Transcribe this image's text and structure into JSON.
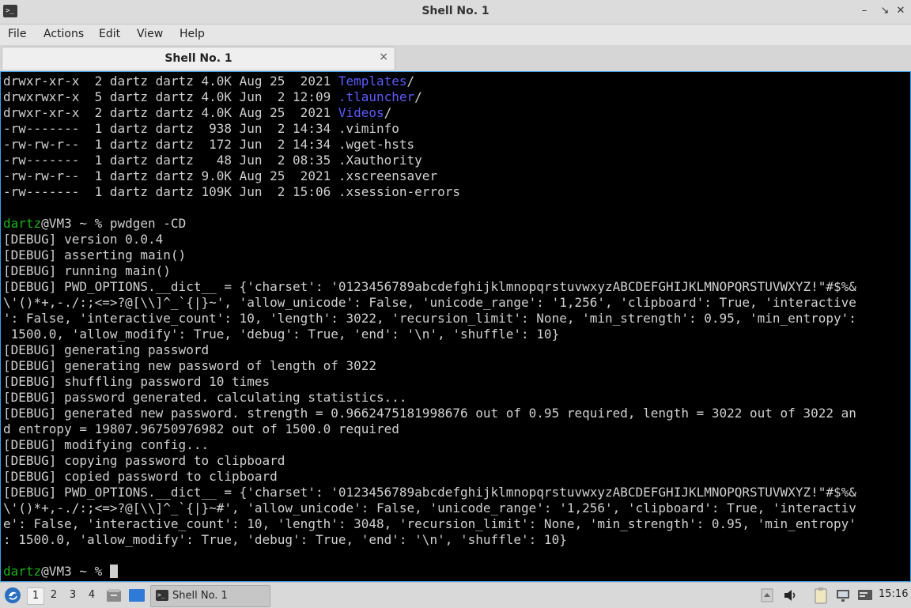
{
  "window": {
    "title": "Shell No. 1",
    "app_icon": "terminal-icon",
    "controls": [
      "minimize-icon",
      "maximize-icon",
      "close-icon"
    ]
  },
  "menubar": {
    "items": [
      "File",
      "Actions",
      "Edit",
      "View",
      "Help"
    ]
  },
  "tab": {
    "label": "Shell No. 1",
    "close": "×"
  },
  "terminal": {
    "colors": {
      "background": "#000000",
      "text": "#d0d0d0",
      "prompt_user": "#18b218",
      "directory": "#5c5cff"
    },
    "lines": [
      [
        {
          "t": "drwxr-xr-x  2 dartz dartz 4.0K Aug 25  2021 "
        },
        {
          "t": "Templates",
          "c": "blue"
        },
        {
          "t": "/"
        }
      ],
      [
        {
          "t": "drwxrwxr-x  5 dartz dartz 4.0K Jun  2 12:09 "
        },
        {
          "t": ".tlauncher",
          "c": "blue"
        },
        {
          "t": "/"
        }
      ],
      [
        {
          "t": "drwxr-xr-x  2 dartz dartz 4.0K Aug 25  2021 "
        },
        {
          "t": "Videos",
          "c": "blue"
        },
        {
          "t": "/"
        }
      ],
      [
        {
          "t": "-rw-------  1 dartz dartz  938 Jun  2 14:34 .viminfo"
        }
      ],
      [
        {
          "t": "-rw-rw-r--  1 dartz dartz  172 Jun  2 14:34 .wget-hsts"
        }
      ],
      [
        {
          "t": "-rw-------  1 dartz dartz   48 Jun  2 08:35 .Xauthority"
        }
      ],
      [
        {
          "t": "-rw-rw-r--  1 dartz dartz 9.0K Aug 25  2021 .xscreensaver"
        }
      ],
      [
        {
          "t": "-rw-------  1 dartz dartz 109K Jun  2 15:06 .xsession-errors"
        }
      ],
      [
        {
          "t": ""
        }
      ],
      [
        {
          "t": "dartz",
          "c": "green"
        },
        {
          "t": "@VM3 ~ % pwdgen -CD"
        }
      ],
      [
        {
          "t": "[DEBUG] version 0.0.4"
        }
      ],
      [
        {
          "t": "[DEBUG] asserting main()"
        }
      ],
      [
        {
          "t": "[DEBUG] running main()"
        }
      ],
      [
        {
          "t": "[DEBUG] PWD_OPTIONS.__dict__ = {'charset': '0123456789abcdefghijklmnopqrstuvwxyzABCDEFGHIJKLMNOPQRSTUVWXYZ!\"#$%&"
        }
      ],
      [
        {
          "t": "\\'()*+,-./:;<=>?@[\\\\]^_`{|}~', 'allow_unicode': False, 'unicode_range': '1,256', 'clipboard': True, 'interactive"
        }
      ],
      [
        {
          "t": "': False, 'interactive_count': 10, 'length': 3022, 'recursion_limit': None, 'min_strength': 0.95, 'min_entropy':"
        }
      ],
      [
        {
          "t": " 1500.0, 'allow_modify': True, 'debug': True, 'end': '\\n', 'shuffle': 10}"
        }
      ],
      [
        {
          "t": "[DEBUG] generating password"
        }
      ],
      [
        {
          "t": "[DEBUG] generating new password of length of 3022"
        }
      ],
      [
        {
          "t": "[DEBUG] shuffling password 10 times"
        }
      ],
      [
        {
          "t": "[DEBUG] password generated. calculating statistics..."
        }
      ],
      [
        {
          "t": "[DEBUG] generated new password. strength = 0.9662475181998676 out of 0.95 required, length = 3022 out of 3022 an"
        }
      ],
      [
        {
          "t": "d entropy = 19807.96750976982 out of 1500.0 required"
        }
      ],
      [
        {
          "t": "[DEBUG] modifying config..."
        }
      ],
      [
        {
          "t": "[DEBUG] copying password to clipboard"
        }
      ],
      [
        {
          "t": "[DEBUG] copied password to clipboard"
        }
      ],
      [
        {
          "t": "[DEBUG] PWD_OPTIONS.__dict__ = {'charset': '0123456789abcdefghijklmnopqrstuvwxyzABCDEFGHIJKLMNOPQRSTUVWXYZ!\"#$%&"
        }
      ],
      [
        {
          "t": "\\'()*+,-./:;<=>?@[\\\\]^_`{|}~#', 'allow_unicode': False, 'unicode_range': '1,256', 'clipboard': True, 'interactiv"
        }
      ],
      [
        {
          "t": "e': False, 'interactive_count': 10, 'length': 3048, 'recursion_limit': None, 'min_strength': 0.95, 'min_entropy'"
        }
      ],
      [
        {
          "t": ": 1500.0, 'allow_modify': True, 'debug': True, 'end': '\\n', 'shuffle': 10}"
        }
      ],
      [
        {
          "t": ""
        }
      ],
      [
        {
          "t": "dartz",
          "c": "green"
        },
        {
          "t": "@VM3 ~ % "
        },
        {
          "cursor": true
        }
      ]
    ]
  },
  "taskbar": {
    "start_icon": "app-menu-icon",
    "workspaces": [
      "1",
      "2",
      "3",
      "4"
    ],
    "active_workspace": "1",
    "launchers": [
      "file-manager-icon",
      "show-desktop-icon"
    ],
    "task": {
      "label": "Shell No. 1",
      "icon": "terminal-icon"
    },
    "tray": [
      "scroll-up-icon",
      "volume-icon",
      "clipboard-icon",
      "network-icon",
      "notification-icon"
    ],
    "clock": "15:16"
  }
}
